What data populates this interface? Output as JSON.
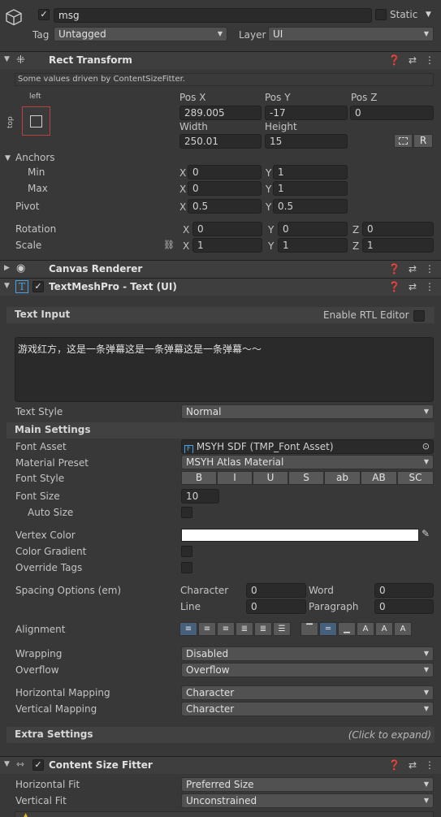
{
  "object": {
    "name": "msg",
    "static_label": "Static",
    "tag_label": "Tag",
    "tag_value": "Untagged",
    "layer_label": "Layer",
    "layer_value": "UI"
  },
  "rect_transform": {
    "title": "Rect Transform",
    "driven_note": "Some values driven by ContentSizeFitter.",
    "anchor_widget": {
      "left": "left",
      "top": "top"
    },
    "pos_x_label": "Pos X",
    "pos_y_label": "Pos Y",
    "pos_z_label": "Pos Z",
    "pos_x": "289.005",
    "pos_y": "-17",
    "pos_z": "0",
    "width_label": "Width",
    "height_label": "Height",
    "width": "250.01",
    "height": "15",
    "r_button": "R",
    "anchors_label": "Anchors",
    "min_label": "Min",
    "max_label": "Max",
    "min_x": "0",
    "min_y": "1",
    "max_x": "0",
    "max_y": "1",
    "pivot_label": "Pivot",
    "pivot_x": "0.5",
    "pivot_y": "0.5",
    "rotation_label": "Rotation",
    "rot_x": "0",
    "rot_y": "0",
    "rot_z": "0",
    "scale_label": "Scale",
    "scale_x": "1",
    "scale_y": "1",
    "scale_z": "1",
    "axis_x": "X",
    "axis_y": "Y",
    "axis_z": "Z"
  },
  "canvas_renderer": {
    "title": "Canvas Renderer"
  },
  "tmp": {
    "title": "TextMeshPro - Text (UI)",
    "text_input_label": "Text Input",
    "rtl_label": "Enable RTL Editor",
    "text_value": "游戏红方，这是一条弹幕这是一条弹幕这是一条弹幕～～",
    "text_style_label": "Text Style",
    "text_style_value": "Normal",
    "main_settings": "Main Settings",
    "font_asset_label": "Font Asset",
    "font_asset_value": "MSYH SDF (TMP_Font Asset)",
    "material_preset_label": "Material Preset",
    "material_preset_value": "MSYH Atlas Material",
    "font_style_label": "Font Style",
    "font_style_buttons": [
      "B",
      "I",
      "U",
      "S",
      "ab",
      "AB",
      "SC"
    ],
    "font_size_label": "Font Size",
    "font_size_value": "10",
    "auto_size_label": "Auto Size",
    "vertex_color_label": "Vertex Color",
    "vertex_color": "#ffffff",
    "color_gradient_label": "Color Gradient",
    "override_tags_label": "Override Tags",
    "spacing_label": "Spacing Options (em)",
    "character_label": "Character",
    "character_value": "0",
    "word_label": "Word",
    "word_value": "0",
    "line_label": "Line",
    "line_value": "0",
    "paragraph_label": "Paragraph",
    "paragraph_value": "0",
    "alignment_label": "Alignment",
    "wrapping_label": "Wrapping",
    "wrapping_value": "Disabled",
    "overflow_label": "Overflow",
    "overflow_value": "Overflow",
    "hmap_label": "Horizontal Mapping",
    "hmap_value": "Character",
    "vmap_label": "Vertical Mapping",
    "vmap_value": "Character",
    "extra_settings": "Extra Settings",
    "click_to_expand": "(Click to expand)"
  },
  "content_size_fitter": {
    "title": "Content Size Fitter",
    "hfit_label": "Horizontal Fit",
    "hfit_value": "Preferred Size",
    "vfit_label": "Vertical Fit",
    "vfit_value": "Unconstrained"
  }
}
